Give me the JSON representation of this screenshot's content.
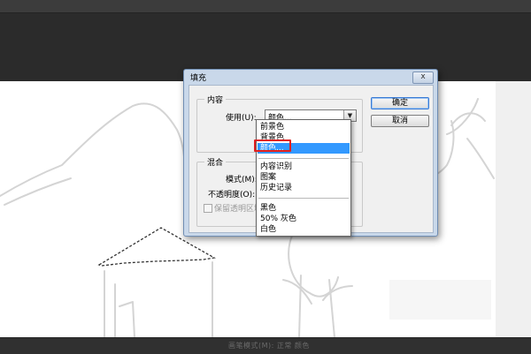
{
  "dialog": {
    "title": "填充",
    "close_label": "x",
    "content_group": {
      "legend": "内容",
      "use_label": "使用(U):",
      "use_value": "颜色..."
    },
    "blend_group": {
      "legend": "混合",
      "mode_label": "模式(M):",
      "opacity_label": "不透明度(O):",
      "preserve_label": "保留透明区域"
    },
    "ok_label": "确定",
    "cancel_label": "取消"
  },
  "dropdown": {
    "items": [
      "前景色",
      "背景色",
      "颜色...",
      "内容识别",
      "图案",
      "历史记录",
      "黑色",
      "50% 灰色",
      "白色"
    ],
    "selected_index": 2
  },
  "statusbar": {
    "text": "画笔模式(M):  正常  颜色"
  }
}
